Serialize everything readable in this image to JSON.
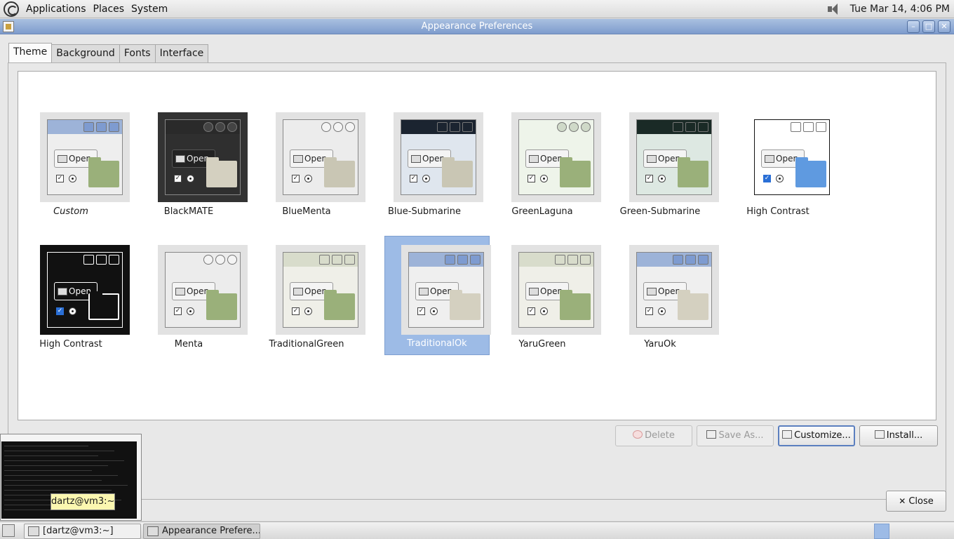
{
  "top_panel": {
    "menus": [
      "Applications",
      "Places",
      "System"
    ],
    "clock": "Tue Mar 14,  4:06 PM"
  },
  "window": {
    "title": "Appearance Preferences",
    "controls": {
      "minimize": "–",
      "maximize": "□",
      "close": "✕"
    },
    "tabs": [
      "Theme",
      "Background",
      "Fonts",
      "Interface"
    ],
    "active_tab": "Theme"
  },
  "themes": [
    {
      "name": "Custom",
      "title_bg": "#9db3d8",
      "body_bg": "#eeeeee",
      "btn_bg": "#7e9bd0",
      "folder": "#9ab07a",
      "round": false,
      "italic": true
    },
    {
      "name": "BlackMATE",
      "title_bg": "#2a2a2a",
      "body_bg": "#2f2f2f",
      "btn_bg": "#444444",
      "folder": "#d4d0c0",
      "round": true,
      "italic": false
    },
    {
      "name": "BlueMenta",
      "title_bg": "#ececec",
      "body_bg": "#ececec",
      "btn_bg": "#f4f4f4",
      "folder": "#c9c6b4",
      "round": true,
      "italic": false
    },
    {
      "name": "Blue-Submarine",
      "title_bg": "#1b2430",
      "body_bg": "#dfe6ee",
      "btn_bg": "#1b2430",
      "folder": "#c9c6b4",
      "round": false,
      "italic": false
    },
    {
      "name": "GreenLaguna",
      "title_bg": "#eef4ea",
      "body_bg": "#eef4ea",
      "btn_bg": "#cfd9c8",
      "folder": "#9ab07a",
      "round": true,
      "italic": false
    },
    {
      "name": "Green-Submarine",
      "title_bg": "#1a2a26",
      "body_bg": "#dde8e2",
      "btn_bg": "#1a2a26",
      "folder": "#9ab07a",
      "round": false,
      "italic": false
    },
    {
      "name": "High Contrast",
      "title_bg": "#ffffff",
      "body_bg": "#ffffff",
      "btn_bg": "#ffffff",
      "folder": "#5f9ae0",
      "round": false,
      "italic": false
    },
    {
      "name": "High Contrast",
      "title_bg": "#111111",
      "body_bg": "#111111",
      "btn_bg": "#111111",
      "folder": "#111111",
      "round": false,
      "italic": false
    },
    {
      "name": "Menta",
      "title_bg": "#ececec",
      "body_bg": "#ececec",
      "btn_bg": "#f4f4f4",
      "folder": "#9ab07a",
      "round": true,
      "italic": false
    },
    {
      "name": "TraditionalGreen",
      "title_bg": "#d8dccb",
      "body_bg": "#efefe8",
      "btn_bg": "#d8dccb",
      "folder": "#9ab07a",
      "round": false,
      "italic": false
    },
    {
      "name": "TraditionalOk",
      "title_bg": "#9db3d8",
      "body_bg": "#efefef",
      "btn_bg": "#7e9bd0",
      "folder": "#d4d0c0",
      "round": false,
      "italic": false,
      "selected": true
    },
    {
      "name": "YaruGreen",
      "title_bg": "#d8dccb",
      "body_bg": "#efefe8",
      "btn_bg": "#d8dccb",
      "folder": "#9ab07a",
      "round": false,
      "italic": false
    },
    {
      "name": "YaruOk",
      "title_bg": "#9db3d8",
      "body_bg": "#efefef",
      "btn_bg": "#7e9bd0",
      "folder": "#d4d0c0",
      "round": false,
      "italic": false
    }
  ],
  "thumb_open_label": "Open",
  "actions": {
    "delete": "Delete",
    "save_as": "Save As...",
    "customize": "Customize...",
    "install": "Install...",
    "close": "Close"
  },
  "terminal_tooltip": "dartz@vm3:~",
  "taskbar": {
    "items": [
      "[dartz@vm3:~]",
      "Appearance Prefere..."
    ]
  },
  "colors": {
    "selection": "#9dbbe6",
    "titlebar": "#8aa6d2"
  }
}
